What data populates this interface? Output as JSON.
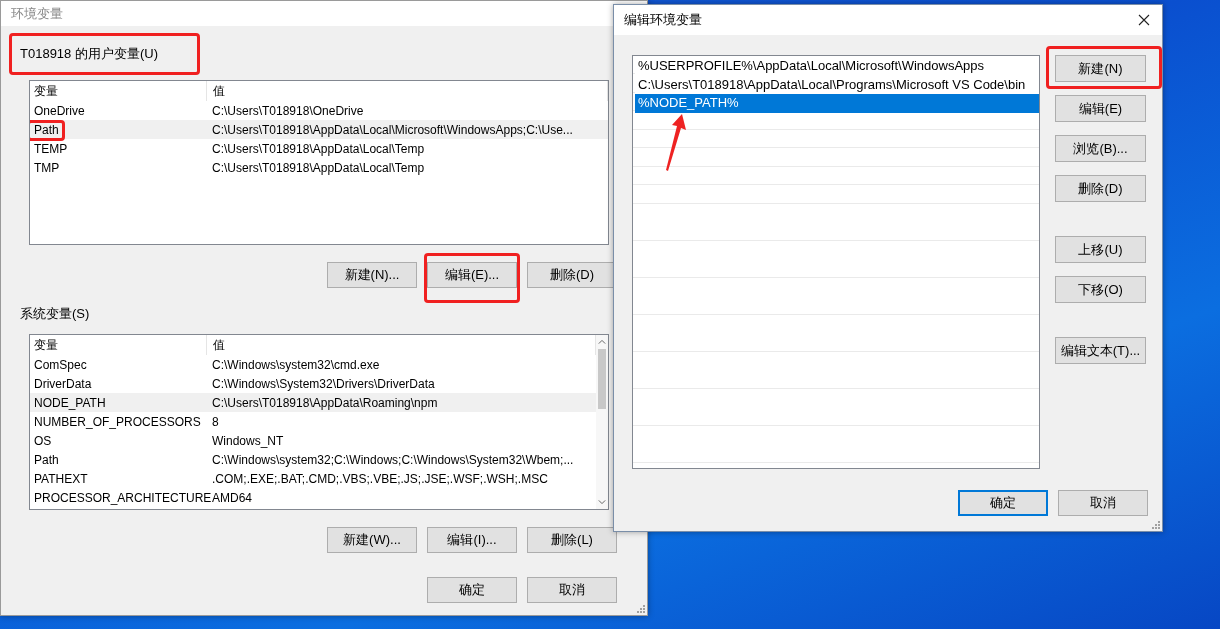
{
  "env_window": {
    "title": "环境变量",
    "user_section": {
      "title": "T018918 的用户变量(U)",
      "highlighted": true,
      "columns": [
        "变量",
        "值"
      ],
      "rows": [
        {
          "name": "OneDrive",
          "value": "C:\\Users\\T018918\\OneDrive",
          "selected": false,
          "highlighted": false
        },
        {
          "name": "Path",
          "value": "C:\\Users\\T018918\\AppData\\Local\\Microsoft\\WindowsApps;C:\\Use...",
          "selected": true,
          "highlighted": true
        },
        {
          "name": "TEMP",
          "value": "C:\\Users\\T018918\\AppData\\Local\\Temp",
          "selected": false,
          "highlighted": false
        },
        {
          "name": "TMP",
          "value": "C:\\Users\\T018918\\AppData\\Local\\Temp",
          "selected": false,
          "highlighted": false
        }
      ],
      "buttons": [
        {
          "label": "新建(N)...",
          "highlighted": false
        },
        {
          "label": "编辑(E)...",
          "highlighted": true
        },
        {
          "label": "删除(D)",
          "highlighted": false
        }
      ]
    },
    "system_section": {
      "title": "系统变量(S)",
      "highlighted": false,
      "columns": [
        "变量",
        "值"
      ],
      "rows": [
        {
          "name": "ComSpec",
          "value": "C:\\Windows\\system32\\cmd.exe",
          "selected": false,
          "highlighted": false
        },
        {
          "name": "DriverData",
          "value": "C:\\Windows\\System32\\Drivers\\DriverData",
          "selected": false,
          "highlighted": false
        },
        {
          "name": "NODE_PATH",
          "value": "C:\\Users\\T018918\\AppData\\Roaming\\npm",
          "selected": true,
          "highlighted": false
        },
        {
          "name": "NUMBER_OF_PROCESSORS",
          "value": "8",
          "selected": false,
          "highlighted": false
        },
        {
          "name": "OS",
          "value": "Windows_NT",
          "selected": false,
          "highlighted": false
        },
        {
          "name": "Path",
          "value": "C:\\Windows\\system32;C:\\Windows;C:\\Windows\\System32\\Wbem;...",
          "selected": false,
          "highlighted": false
        },
        {
          "name": "PATHEXT",
          "value": ".COM;.EXE;.BAT;.CMD;.VBS;.VBE;.JS;.JSE;.WSF;.WSH;.MSC",
          "selected": false,
          "highlighted": false
        },
        {
          "name": "PROCESSOR_ARCHITECTURE",
          "value": "AMD64",
          "selected": false,
          "highlighted": false
        }
      ],
      "buttons": [
        {
          "label": "新建(W)...",
          "highlighted": false
        },
        {
          "label": "编辑(I)...",
          "highlighted": false
        },
        {
          "label": "删除(L)",
          "highlighted": false
        }
      ]
    },
    "buttons": [
      {
        "label": "确定",
        "default": false
      },
      {
        "label": "取消",
        "default": false
      }
    ]
  },
  "edit_dialog": {
    "title": "编辑环境变量",
    "entries": [
      {
        "text": "%USERPROFILE%\\AppData\\Local\\Microsoft\\WindowsApps",
        "selected": false
      },
      {
        "text": "C:\\Users\\T018918\\AppData\\Local\\Programs\\Microsoft VS Code\\bin",
        "selected": false
      },
      {
        "text": "%NODE_PATH%",
        "selected": true
      }
    ],
    "side_button_groups": [
      [
        {
          "label": "新建(N)",
          "highlighted": true
        },
        {
          "label": "编辑(E)",
          "highlighted": false
        },
        {
          "label": "浏览(B)...",
          "highlighted": false
        },
        {
          "label": "删除(D)",
          "highlighted": false
        }
      ],
      [
        {
          "label": "上移(U)",
          "highlighted": false
        },
        {
          "label": "下移(O)",
          "highlighted": false
        }
      ],
      [
        {
          "label": "编辑文本(T)...",
          "highlighted": false
        }
      ]
    ],
    "buttons": [
      {
        "label": "确定",
        "default": true
      },
      {
        "label": "取消",
        "default": false
      }
    ]
  }
}
